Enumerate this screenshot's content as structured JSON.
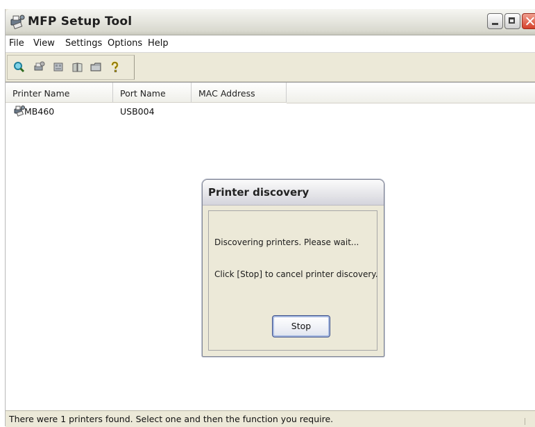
{
  "window": {
    "title": "MFP Setup Tool",
    "icon": "printer-network-icon"
  },
  "menu": [
    {
      "label": "File"
    },
    {
      "label": "View"
    },
    {
      "label": "Settings"
    },
    {
      "label": "Options"
    },
    {
      "label": "Help"
    }
  ],
  "toolbar": {
    "icons": [
      "search-icon",
      "printer-settings-icon",
      "network-card-icon",
      "book-icon",
      "folder-icon",
      "help-icon"
    ]
  },
  "list": {
    "columns": [
      "Printer Name",
      "Port Name",
      "MAC Address"
    ],
    "rows": [
      {
        "printer_name": "MB460",
        "port_name": "USB004",
        "mac_address": ""
      }
    ]
  },
  "dialog": {
    "title": "Printer discovery",
    "message_1": "Discovering printers. Please wait...",
    "message_2": "Click [Stop] to cancel printer discovery.",
    "stop_label": "Stop"
  },
  "status": {
    "text": "There were 1 printers found. Select one and then the function you require."
  },
  "colors": {
    "window_bg": "#ece9d8",
    "list_bg": "#ffffff",
    "close_button": "#d5412a",
    "stop_button_focus": "#a7b9e0"
  }
}
